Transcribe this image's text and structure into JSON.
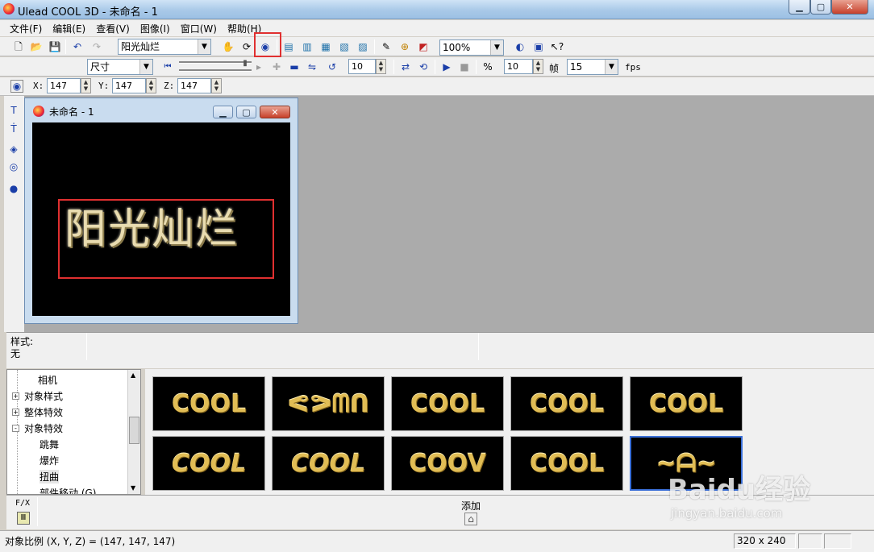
{
  "window": {
    "title": "Ulead COOL 3D - 未命名 - 1"
  },
  "menu": [
    "文件(F)",
    "编辑(E)",
    "查看(V)",
    "图像(I)",
    "窗口(W)",
    "帮助(H)"
  ],
  "toolbar": {
    "text_select": "阳光灿烂",
    "zoom": "100%"
  },
  "anim_toolbar": {
    "attribute_select": "尺寸",
    "frame_value": "10",
    "frames": "10",
    "frames_label": "帧",
    "fps": "15",
    "fps_label": "fps"
  },
  "xyz": {
    "x_label": "X:",
    "x": "147",
    "y_label": "Y:",
    "y": "147",
    "z_label": "Z:",
    "z": "147"
  },
  "doc": {
    "title": "未命名 - 1",
    "text": "阳光灿烂"
  },
  "style_panel": {
    "label": "样式:",
    "value": "无"
  },
  "tree": [
    {
      "label": "相机",
      "indent": 2,
      "expander": ""
    },
    {
      "label": "对象样式",
      "indent": 1,
      "expander": "+"
    },
    {
      "label": "整体特效",
      "indent": 1,
      "expander": "+"
    },
    {
      "label": "对象特效",
      "indent": 1,
      "expander": "-"
    },
    {
      "label": "跳舞",
      "indent": 2,
      "expander": ""
    },
    {
      "label": "爆炸",
      "indent": 2,
      "expander": ""
    },
    {
      "label": "扭曲",
      "indent": 2,
      "expander": ""
    },
    {
      "label": "部件移动 (G)",
      "indent": 2,
      "expander": ""
    }
  ],
  "gallery": [
    "COOL",
    "ᕙᕗᗰᑎ",
    "COOL",
    "COOL",
    "COOL",
    "COOL",
    "COOL",
    "COOV",
    "COOL",
    "~ᗩ~"
  ],
  "fx": {
    "label": "F/X",
    "add_label": "添加"
  },
  "status": {
    "text": "对象比例 (X, Y, Z) = (147, 147, 147)",
    "size": "320 x 240"
  },
  "watermark": {
    "brand": "Baidu经验",
    "url": "jingyan.baidu.com"
  }
}
